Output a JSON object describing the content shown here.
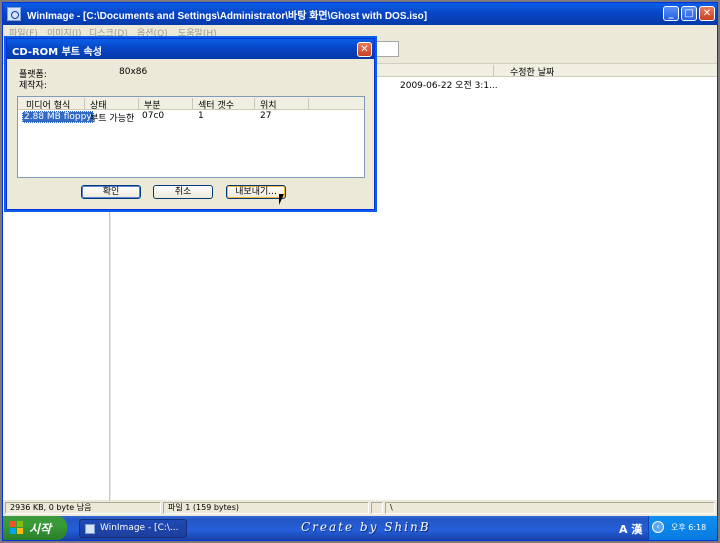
{
  "window": {
    "title": "WinImage - [C:\\Documents and Settings\\Administrator\\바탕 화면\\Ghost with DOS.iso]",
    "controls": {
      "minimize": "_",
      "maximize": "□",
      "close": "✕"
    }
  },
  "menu": [
    "파일(F)",
    "이미지(I)",
    "디스크(D)",
    "옵션(O)",
    "도움말(H)"
  ],
  "file_list": {
    "date_column_header": "수정한 날짜",
    "rows": [
      {
        "date": "2009-06-22  오전 3:1..."
      }
    ]
  },
  "status": {
    "disk": "2936 KB, 0 byte 남음",
    "files": "파일 1 (159 bytes)",
    "path": "\\"
  },
  "taskbar": {
    "start_label": "시작",
    "task_label": "WinImage - [C:\\...",
    "watermark": "Create by ShinB",
    "ime": "A 漢",
    "clock": "오후 6:18"
  },
  "dialog": {
    "title": "CD-ROM 부트 속성",
    "close": "✕",
    "platform_label": "플랫폼:",
    "platform_value": "80x86",
    "maker_label": "제작자:",
    "list": {
      "columns": [
        "미디어 형식",
        "상태",
        "부분",
        "섹터 갯수",
        "위치"
      ],
      "rows": [
        {
          "media": "2.88 MB floppy",
          "status": "부트 가능한",
          "segment": "07c0",
          "sectors": "1",
          "location": "27"
        }
      ]
    },
    "buttons": {
      "ok": "확인",
      "cancel": "취소",
      "export": "내보내기..."
    }
  },
  "colors": {
    "title_blue": "#0a5fe8",
    "selection": "#316ac5",
    "face": "#ece9d8",
    "start_green": "#379a37"
  }
}
